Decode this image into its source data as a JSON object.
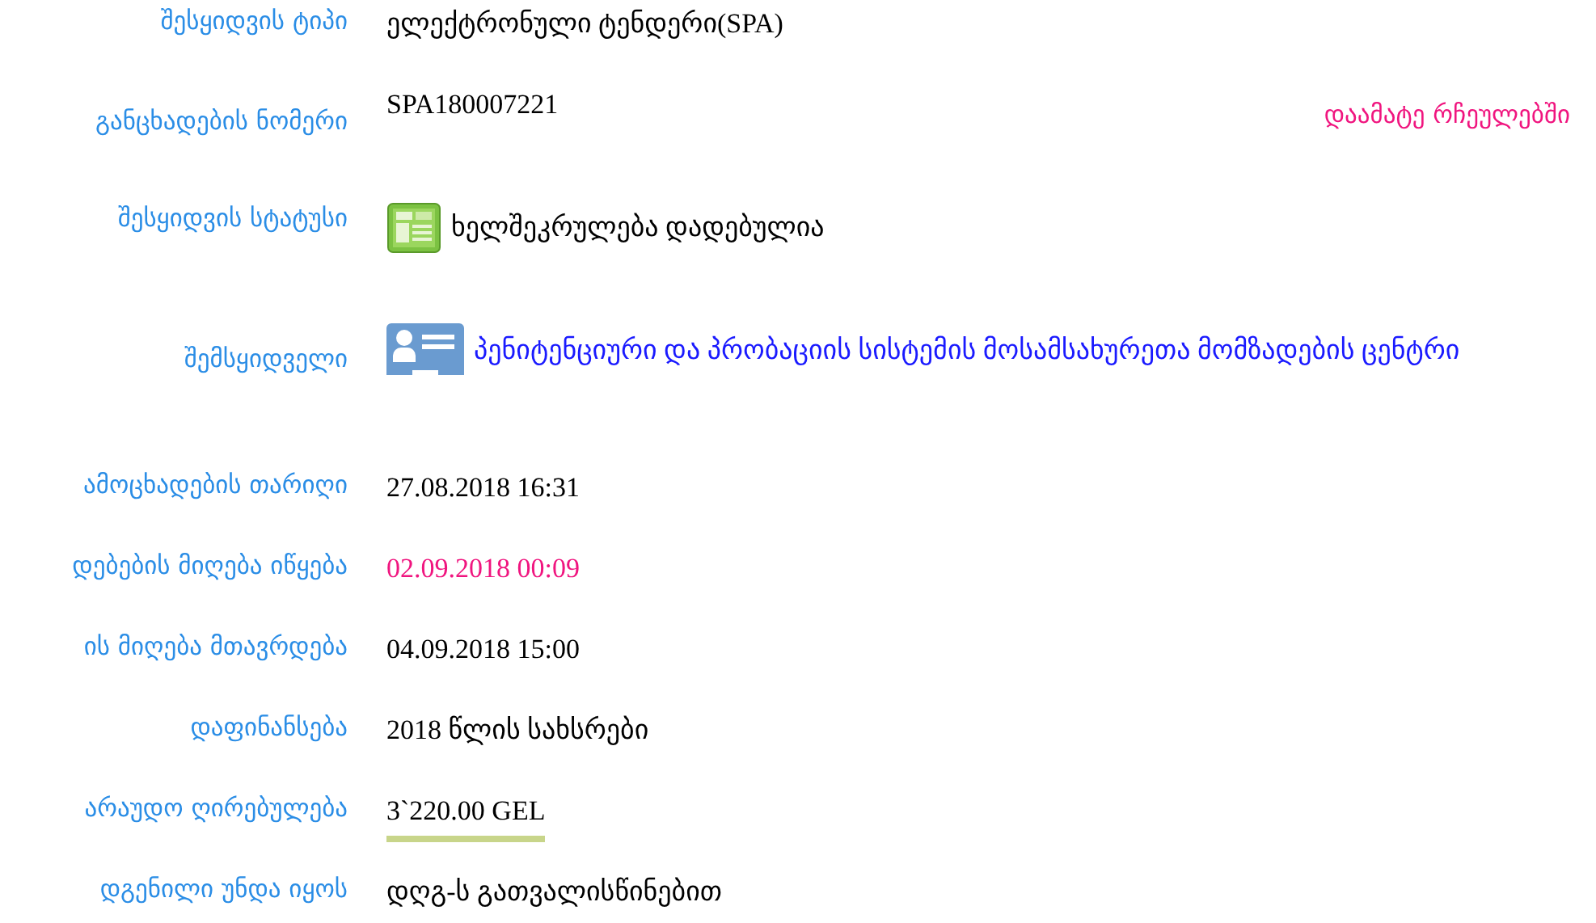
{
  "rows": [
    {
      "label": "შესყიდვის ტიპი",
      "value": "ელექტრონული ტენდერი(SPA)",
      "kind": "text"
    },
    {
      "label": "განცხადების ნომერი",
      "value": "SPA180007221",
      "kind": "text",
      "action": "დაამატე რჩეულებში"
    },
    {
      "label": "შესყიდვის სტატუსი",
      "value": "ხელშეკრულება დადებულია",
      "kind": "status"
    },
    {
      "label": "შემსყიდველი",
      "value": "პენიტენციური და პრობაციის სისტემის მოსამსახურეთა მომზადების ცენტრი",
      "kind": "organization"
    },
    {
      "label": "ამოცხადების თარიღი",
      "value": "27.08.2018 16:31",
      "kind": "text"
    },
    {
      "label": "დებების მიღება იწყება",
      "value": "02.09.2018 00:09",
      "kind": "highlighted"
    },
    {
      "label": "ის მიღება მთავრდება",
      "value": "04.09.2018 15:00",
      "kind": "text"
    },
    {
      "label": "დაფინანსება",
      "value": "2018 წლის სახსრები",
      "kind": "text"
    },
    {
      "label": "არაუდო ღირებულება",
      "value": "3`220.00 GEL",
      "kind": "amount"
    },
    {
      "label": "დგენილი უნდა იყოს",
      "value": "დღგ-ს გათვალისწინებით",
      "kind": "text"
    }
  ]
}
